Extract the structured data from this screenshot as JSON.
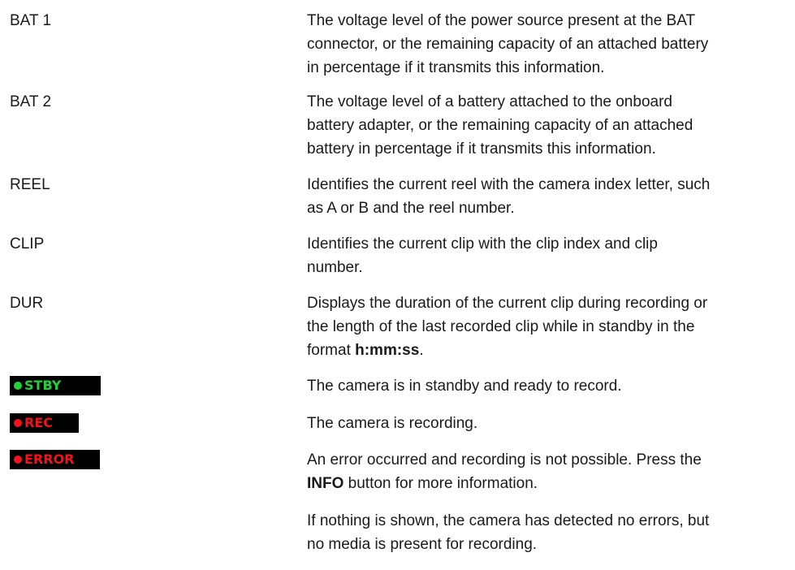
{
  "rows": [
    {
      "term": "BAT 1",
      "lines": [
        "The voltage level of the power source present at the BAT",
        "connector, or the remaining capacity of an attached battery",
        "in percentage if it transmits this information."
      ]
    },
    {
      "term": "BAT 2",
      "lines": [
        "The voltage level of a battery attached to the onboard",
        "battery adapter, or the remaining capacity of an attached",
        "battery in percentage if it transmits this information."
      ]
    },
    {
      "term": "REEL",
      "lines": [
        "Identifies the current reel with the camera index letter, such",
        "as A or B and the reel number."
      ]
    },
    {
      "term": "CLIP",
      "lines": [
        "Identifies the current clip with the clip index and clip",
        "number."
      ]
    },
    {
      "term": "DUR",
      "lines": [
        "Displays the duration of the current clip during recording or",
        "the length of the last recorded clip while in standby in the"
      ],
      "line3_prefix": "format ",
      "line3_bold": "h:mm:ss",
      "line3_suffix": "."
    }
  ],
  "status": {
    "stby": {
      "badge": "STBY",
      "badge_color": "#22d13a",
      "desc": "The camera is in standby and ready to record."
    },
    "rec": {
      "badge": "REC",
      "badge_color": "#f4131a",
      "desc": "The camera is recording."
    },
    "error": {
      "badge": "ERROR",
      "badge_color": "#f4131a",
      "line1": "An error occurred and recording is not possible. Press the",
      "line2_bold": "INFO",
      "line2_suffix": " button for more information."
    }
  },
  "footnote": {
    "line1": "If nothing is shown, the camera has detected no errors, but",
    "line2": "no media is present for recording."
  }
}
